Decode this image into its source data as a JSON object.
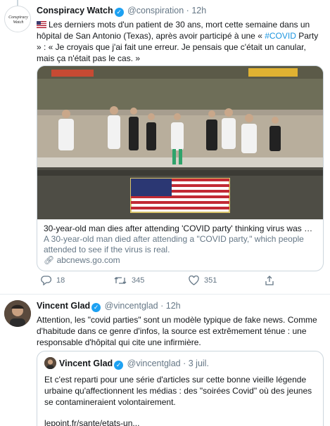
{
  "tweet1": {
    "display_name": "Conspiracy Watch",
    "handle": "@conspiration",
    "separator": "·",
    "time": "12h",
    "avatar_text": "Conspiracy Watch",
    "text_before": "Les derniers mots d'un patient de 30 ans, mort cette semaine dans un hôpital de San Antonio (Texas), après avoir participé à une « ",
    "hashtag": "#COVID",
    "text_after": " Party » : « Je croyais que j'ai fait une erreur. Je pensais que c'était un canular, mais ça n'était pas le cas. »",
    "card": {
      "title": "30-year-old man dies after attending 'COVID party' thinking virus was a ...",
      "description": "A 30-year-old man died after attending a \"COVID party,\" which people attended to see if the virus is real.",
      "domain": "abcnews.go.com"
    },
    "actions": {
      "replies": "18",
      "retweets": "345",
      "likes": "351"
    }
  },
  "tweet2": {
    "display_name": "Vincent Glad",
    "handle": "@vincentglad",
    "separator": "·",
    "time": "12h",
    "text": "Attention, les \"covid parties\" sont un modèle typique de fake news. Comme d'habitude dans ce genre d'infos, la source est extrêmement ténue : une responsable d'hôpital qui cite une infirmière.",
    "quote": {
      "display_name": "Vincent Glad",
      "handle": "@vincentglad",
      "separator": "·",
      "date": "3 juil.",
      "text": "Et c'est reparti pour une série d'articles sur cette bonne vieille légende urbaine qu'affectionnent les médias : des \"soirées Covid\" où des jeunes se contamineraient volontairement.",
      "link": "lepoint.fr/sante/etats-un..."
    }
  },
  "colors": {
    "accent": "#1da1f2",
    "link": "#1b95e0",
    "muted": "#657786",
    "border": "#ccd6dd"
  },
  "icons": {
    "verified": "verified-badge-icon",
    "flag": "us-flag-emoji",
    "reply": "reply-icon",
    "retweet": "retweet-icon",
    "like": "heart-icon",
    "share": "share-icon",
    "link": "link-icon"
  }
}
